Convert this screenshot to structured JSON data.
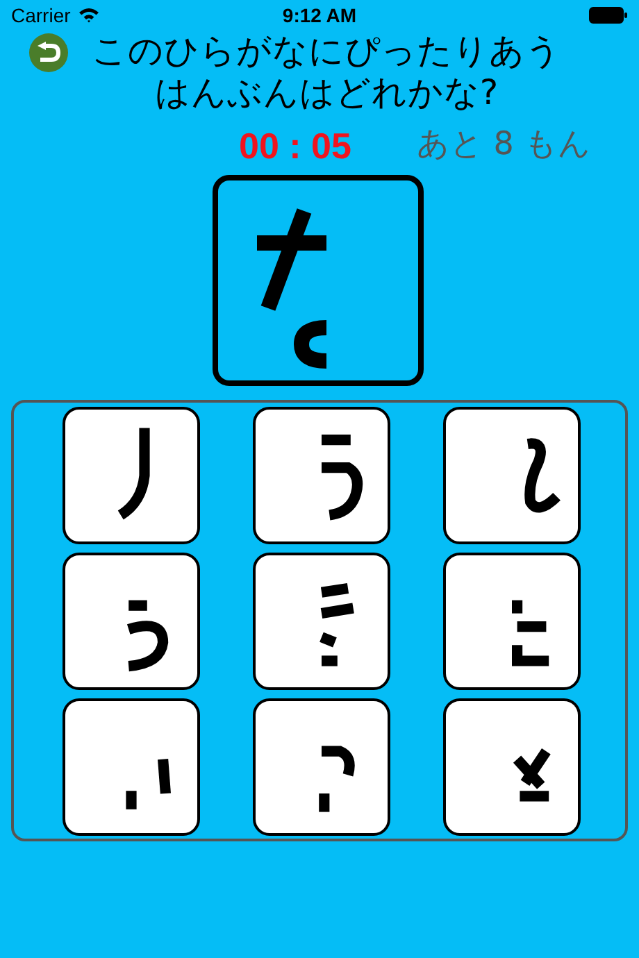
{
  "status_bar": {
    "carrier": "Carrier",
    "time": "9:12 AM"
  },
  "question": {
    "lines": [
      "このひらがなにぴったりあう",
      "はんぶんはどれかな?"
    ]
  },
  "timer": "00 : 05",
  "remaining": "あと 8 もん",
  "target": {
    "kind": "piece"
  },
  "choices": [
    {
      "kind": "piece"
    },
    {
      "kind": "piece"
    },
    {
      "kind": "piece"
    },
    {
      "kind": "piece"
    },
    {
      "kind": "piece"
    },
    {
      "kind": "piece"
    },
    {
      "kind": "piece"
    },
    {
      "kind": "piece"
    },
    {
      "kind": "piece"
    }
  ]
}
